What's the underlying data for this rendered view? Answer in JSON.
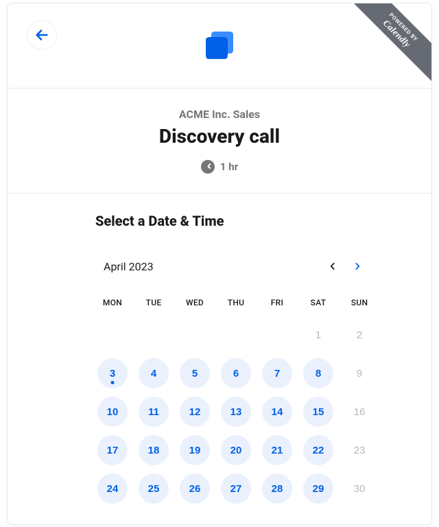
{
  "ribbon": {
    "powered_by": "POWERED BY",
    "brand": "Calendly"
  },
  "meta": {
    "host": "ACME Inc. Sales",
    "title": "Discovery call",
    "duration_label": "1 hr"
  },
  "picker": {
    "heading": "Select a Date & Time",
    "month_label": "April 2023",
    "weekdays": [
      "MON",
      "TUE",
      "WED",
      "THU",
      "FRI",
      "SAT",
      "SUN"
    ],
    "days": [
      {
        "n": "",
        "state": "blank"
      },
      {
        "n": "",
        "state": "blank"
      },
      {
        "n": "",
        "state": "blank"
      },
      {
        "n": "",
        "state": "blank"
      },
      {
        "n": "",
        "state": "blank"
      },
      {
        "n": "1",
        "state": "muted"
      },
      {
        "n": "2",
        "state": "muted"
      },
      {
        "n": "3",
        "state": "available",
        "today": true
      },
      {
        "n": "4",
        "state": "available"
      },
      {
        "n": "5",
        "state": "available"
      },
      {
        "n": "6",
        "state": "available"
      },
      {
        "n": "7",
        "state": "available"
      },
      {
        "n": "8",
        "state": "available"
      },
      {
        "n": "9",
        "state": "muted"
      },
      {
        "n": "10",
        "state": "available"
      },
      {
        "n": "11",
        "state": "available"
      },
      {
        "n": "12",
        "state": "available"
      },
      {
        "n": "13",
        "state": "available"
      },
      {
        "n": "14",
        "state": "available"
      },
      {
        "n": "15",
        "state": "available"
      },
      {
        "n": "16",
        "state": "muted"
      },
      {
        "n": "17",
        "state": "available"
      },
      {
        "n": "18",
        "state": "available"
      },
      {
        "n": "19",
        "state": "available"
      },
      {
        "n": "20",
        "state": "available"
      },
      {
        "n": "21",
        "state": "available"
      },
      {
        "n": "22",
        "state": "available"
      },
      {
        "n": "23",
        "state": "muted"
      },
      {
        "n": "24",
        "state": "available"
      },
      {
        "n": "25",
        "state": "available"
      },
      {
        "n": "26",
        "state": "available"
      },
      {
        "n": "27",
        "state": "available"
      },
      {
        "n": "28",
        "state": "available"
      },
      {
        "n": "29",
        "state": "available"
      },
      {
        "n": "30",
        "state": "muted"
      }
    ]
  }
}
